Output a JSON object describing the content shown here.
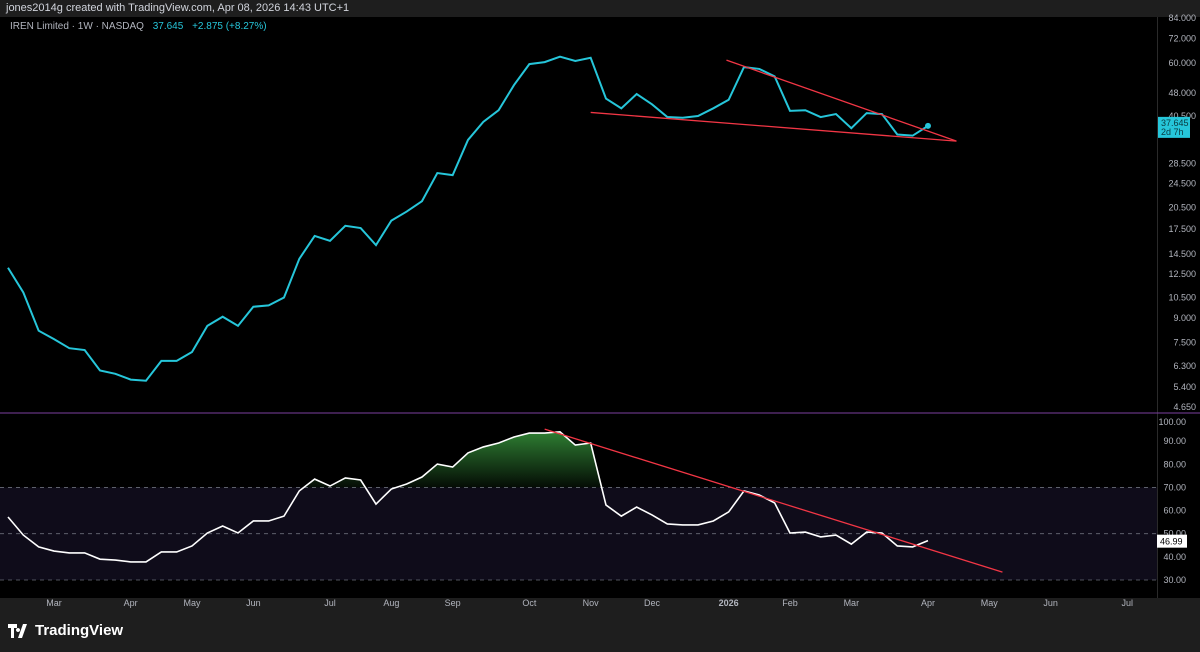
{
  "header": {
    "credit": "jones2014g created with TradingView.com, Apr 08, 2026 14:43 UTC+1"
  },
  "legend": {
    "symbol": "IREN Limited · 1W · NASDAQ",
    "price": "37.645",
    "change": "+2.875 (+8.27%)"
  },
  "brand": {
    "name": "TradingView"
  },
  "colors": {
    "price_line": "#26c6da",
    "rsi_line": "#ffffff",
    "trendline": "#f23645",
    "separator": "#7b3fa0",
    "rsi_band": "#0f0c1a",
    "fill_overbought": "#2e7d32"
  },
  "chart_data": [
    {
      "type": "line",
      "pane": "price",
      "scale": "log",
      "ylim": [
        4.4,
        86
      ],
      "y_ticks": [
        "84.000",
        "72.000",
        "60.000",
        "48.000",
        "40.500",
        "28.500",
        "24.500",
        "20.500",
        "17.500",
        "14.500",
        "12.500",
        "10.500",
        "9.000",
        "7.500",
        "6.300",
        "5.400",
        "4.650"
      ],
      "last_label": {
        "value": "37.645",
        "countdown": "2d 7h"
      },
      "x": [
        "2025-02-10",
        "2025-02-17",
        "2025-02-24",
        "2025-03-03",
        "2025-03-10",
        "2025-03-17",
        "2025-03-24",
        "2025-03-31",
        "2025-04-07",
        "2025-04-14",
        "2025-04-21",
        "2025-04-28",
        "2025-05-05",
        "2025-05-12",
        "2025-05-19",
        "2025-05-26",
        "2025-06-02",
        "2025-06-09",
        "2025-06-16",
        "2025-06-23",
        "2025-06-30",
        "2025-07-07",
        "2025-07-14",
        "2025-07-21",
        "2025-07-28",
        "2025-08-04",
        "2025-08-11",
        "2025-08-18",
        "2025-08-25",
        "2025-09-01",
        "2025-09-08",
        "2025-09-15",
        "2025-09-22",
        "2025-09-29",
        "2025-10-06",
        "2025-10-13",
        "2025-10-20",
        "2025-10-27",
        "2025-11-03",
        "2025-11-10",
        "2025-11-17",
        "2025-11-24",
        "2025-12-01",
        "2025-12-08",
        "2025-12-15",
        "2025-12-22",
        "2025-12-29",
        "2026-01-05",
        "2026-01-12",
        "2026-01-19",
        "2026-01-26",
        "2026-02-02",
        "2026-02-09",
        "2026-02-16",
        "2026-02-23",
        "2026-03-02",
        "2026-03-09",
        "2026-03-16",
        "2026-03-23",
        "2026-03-30",
        "2026-04-06"
      ],
      "values": [
        13.1,
        10.9,
        8.2,
        7.7,
        7.2,
        7.1,
        6.1,
        5.95,
        5.7,
        5.65,
        6.55,
        6.55,
        7.0,
        8.5,
        9.1,
        8.5,
        9.8,
        9.9,
        10.5,
        14.0,
        16.6,
        16.0,
        17.9,
        17.6,
        15.5,
        18.6,
        19.9,
        21.5,
        26.5,
        26.1,
        33.9,
        38.8,
        42.3,
        51.0,
        59.6,
        60.5,
        63.0,
        61.0,
        62.5,
        46.1,
        42.9,
        47.7,
        44.2,
        40.2,
        40.0,
        40.5,
        42.9,
        45.7,
        58.3,
        57.5,
        54.4,
        42.1,
        42.3,
        40.2,
        41.1,
        37.0,
        41.4,
        41.1,
        35.3,
        35.0,
        37.645
      ],
      "trendlines": [
        {
          "from": [
            "2026-01-04",
            61.4
          ],
          "to": [
            "2026-04-19",
            33.6
          ]
        },
        {
          "from": [
            "2025-11-03",
            41.6
          ],
          "to": [
            "2026-04-19",
            33.6
          ]
        }
      ]
    },
    {
      "type": "line",
      "pane": "rsi",
      "ylim": [
        27,
        100
      ],
      "y_ticks": [
        "100.00",
        "90.00",
        "80.00",
        "70.00",
        "60.00",
        "50.00",
        "40.00",
        "30.00"
      ],
      "bands": [
        70,
        50,
        30
      ],
      "last_label": "46.99",
      "values": [
        57.2,
        49.4,
        44.3,
        42.5,
        41.7,
        41.7,
        39.0,
        38.6,
        37.8,
        37.8,
        42.1,
        42.1,
        44.7,
        50.3,
        53.3,
        50.3,
        55.5,
        55.5,
        57.6,
        68.5,
        73.6,
        70.6,
        74.1,
        73.2,
        62.8,
        69.3,
        71.5,
        74.5,
        80.1,
        78.8,
        84.9,
        87.5,
        89.2,
        91.8,
        93.5,
        93.5,
        94.0,
        88.3,
        89.2,
        62.4,
        57.6,
        61.5,
        58.1,
        54.2,
        53.8,
        53.8,
        55.5,
        59.4,
        68.5,
        66.7,
        63.3,
        50.3,
        50.7,
        48.6,
        49.4,
        45.5,
        50.7,
        50.3,
        44.7,
        44.3,
        46.99
      ],
      "trendlines": [
        {
          "from": [
            "2025-10-13",
            95.2
          ],
          "to": [
            "2026-05-10",
            33.4
          ]
        }
      ]
    }
  ],
  "x_axis": [
    {
      "date": "2025-03-03",
      "label": "Mar"
    },
    {
      "date": "2025-04-07",
      "label": "Apr"
    },
    {
      "date": "2025-05-05",
      "label": "May"
    },
    {
      "date": "2025-06-02",
      "label": "Jun"
    },
    {
      "date": "2025-07-07",
      "label": "Jul"
    },
    {
      "date": "2025-08-04",
      "label": "Aug"
    },
    {
      "date": "2025-09-01",
      "label": "Sep"
    },
    {
      "date": "2025-10-06",
      "label": "Oct"
    },
    {
      "date": "2025-11-03",
      "label": "Nov"
    },
    {
      "date": "2025-12-01",
      "label": "Dec"
    },
    {
      "date": "2026-01-05",
      "label": "2026"
    },
    {
      "date": "2026-02-02",
      "label": "Feb"
    },
    {
      "date": "2026-03-02",
      "label": "Mar"
    },
    {
      "date": "2026-04-06",
      "label": "Apr"
    },
    {
      "date": "2026-05-04",
      "label": "May"
    },
    {
      "date": "2026-06-01",
      "label": "Jun"
    },
    {
      "date": "2026-07-06",
      "label": "Jul"
    }
  ]
}
